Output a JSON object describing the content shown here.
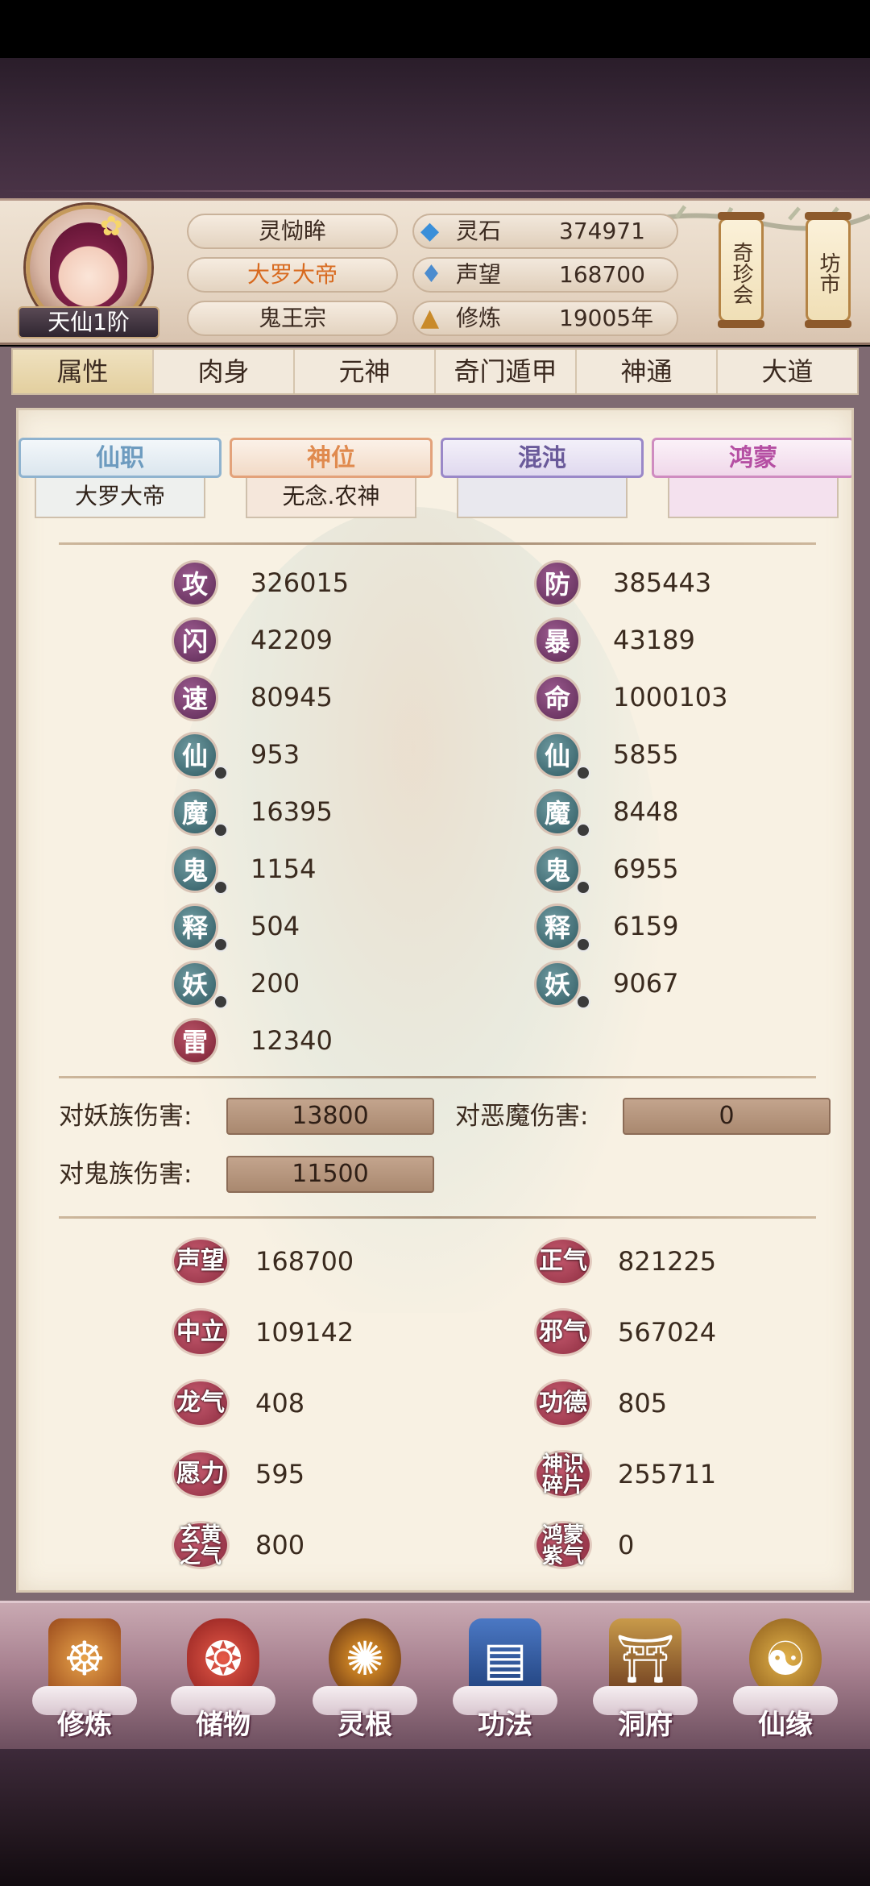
{
  "profile": {
    "rank": "天仙1阶",
    "name": "灵恸眸",
    "title": "大罗大帝",
    "sect": "鬼王宗"
  },
  "resources": [
    {
      "icon": "spirit-stone-icon",
      "label": "灵石",
      "value": "374971"
    },
    {
      "icon": "prestige-icon",
      "label": "声望",
      "value": "168700"
    },
    {
      "icon": "cultivation-icon",
      "label": "修炼",
      "value": "19005年"
    }
  ],
  "shops": {
    "treasure": "奇珍会",
    "market": "坊市"
  },
  "tabs": [
    "属性",
    "肉身",
    "元神",
    "奇门遁甲",
    "神通",
    "大道"
  ],
  "active_tab": "属性",
  "title_tabs": [
    {
      "title": "仙职",
      "value": "大罗大帝",
      "color": "#6d9bbf"
    },
    {
      "title": "神位",
      "value": "无念.农神",
      "color": "#e08a4e"
    },
    {
      "title": "混沌",
      "value": "",
      "color": "#6a5a9a"
    },
    {
      "title": "鸿蒙",
      "value": "",
      "color": "#b54fa3"
    }
  ],
  "stats_left": [
    {
      "glyph": "攻",
      "value": "326015",
      "style": "purple",
      "dot": false
    },
    {
      "glyph": "闪",
      "value": "42209",
      "style": "purple",
      "dot": false
    },
    {
      "glyph": "速",
      "value": "80945",
      "style": "purple",
      "dot": false
    },
    {
      "glyph": "仙",
      "value": "953",
      "style": "teal",
      "dot": true
    },
    {
      "glyph": "魔",
      "value": "16395",
      "style": "teal",
      "dot": true
    },
    {
      "glyph": "鬼",
      "value": "1154",
      "style": "teal",
      "dot": true
    },
    {
      "glyph": "释",
      "value": "504",
      "style": "teal",
      "dot": true
    },
    {
      "glyph": "妖",
      "value": "200",
      "style": "teal",
      "dot": true
    },
    {
      "glyph": "雷",
      "value": "12340",
      "style": "red",
      "dot": false
    }
  ],
  "stats_right": [
    {
      "glyph": "防",
      "value": "385443",
      "style": "purple",
      "dot": false
    },
    {
      "glyph": "暴",
      "value": "43189",
      "style": "purple",
      "dot": false
    },
    {
      "glyph": "命",
      "value": "1000103",
      "style": "purple",
      "dot": false
    },
    {
      "glyph": "仙",
      "value": "5855",
      "style": "teal",
      "dot": true
    },
    {
      "glyph": "魔",
      "value": "8448",
      "style": "teal",
      "dot": true
    },
    {
      "glyph": "鬼",
      "value": "6955",
      "style": "teal",
      "dot": true
    },
    {
      "glyph": "释",
      "value": "6159",
      "style": "teal",
      "dot": true
    },
    {
      "glyph": "妖",
      "value": "9067",
      "style": "teal",
      "dot": true
    }
  ],
  "damage": [
    {
      "label": "对妖族伤害:",
      "value": "13800"
    },
    {
      "label": "对恶魔伤害:",
      "value": "0"
    },
    {
      "label": "对鬼族伤害:",
      "value": "11500"
    }
  ],
  "misc_left": [
    {
      "label": "声望",
      "value": "168700"
    },
    {
      "label": "中立",
      "value": "109142"
    },
    {
      "label": "龙气",
      "value": "408"
    },
    {
      "label": "愿力",
      "value": "595"
    },
    {
      "label": "玄黄之气",
      "value": "800"
    }
  ],
  "misc_right": [
    {
      "label": "正气",
      "value": "821225"
    },
    {
      "label": "邪气",
      "value": "567024"
    },
    {
      "label": "功德",
      "value": "805"
    },
    {
      "label": "神识碎片",
      "value": "255711"
    },
    {
      "label": "鸿蒙紫气",
      "value": "0"
    }
  ],
  "bottom_nav": [
    {
      "label": "修炼",
      "icon": "cultivate-monk-icon"
    },
    {
      "label": "储物",
      "icon": "storage-bag-icon"
    },
    {
      "label": "灵根",
      "icon": "spirit-root-icon"
    },
    {
      "label": "功法",
      "icon": "technique-book-icon"
    },
    {
      "label": "洞府",
      "icon": "cave-abode-icon"
    },
    {
      "label": "仙缘",
      "icon": "gourd-icon"
    }
  ]
}
